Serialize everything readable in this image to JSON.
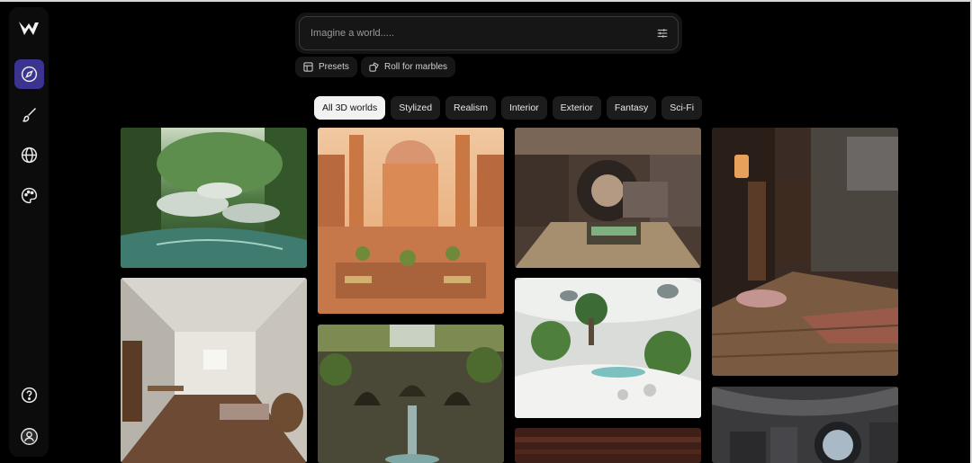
{
  "sidebar": {
    "logo": "marble-logo-icon",
    "items": [
      {
        "icon": "compass-icon",
        "active": true
      },
      {
        "icon": "paintbrush-icon",
        "active": false
      },
      {
        "icon": "globe-icon",
        "active": false
      },
      {
        "icon": "palette-icon",
        "active": false
      }
    ],
    "bottom": [
      {
        "icon": "help-icon"
      },
      {
        "icon": "user-icon"
      }
    ]
  },
  "search": {
    "placeholder": "Imagine a world.....",
    "filter_icon": "sliders-icon"
  },
  "actions": {
    "presets_label": "Presets",
    "roll_label": "Roll for marbles"
  },
  "tabs": [
    {
      "label": "All 3D worlds",
      "active": true
    },
    {
      "label": "Stylized",
      "active": false
    },
    {
      "label": "Realism",
      "active": false
    },
    {
      "label": "Interior",
      "active": false
    },
    {
      "label": "Exterior",
      "active": false
    },
    {
      "label": "Fantasy",
      "active": false
    },
    {
      "label": "Sci-Fi",
      "active": false
    }
  ],
  "gallery": {
    "items": [
      {
        "subject": "forest-treehouse-lagoon"
      },
      {
        "subject": "ornate-palace-courtyard"
      },
      {
        "subject": "circular-library-room"
      },
      {
        "subject": "old-library-interior"
      },
      {
        "subject": "abandoned-hallway"
      },
      {
        "subject": "overgrown-ruins-waterfall"
      },
      {
        "subject": "white-futuristic-garden"
      },
      {
        "subject": "wooden-room"
      },
      {
        "subject": "scifi-porthole-room"
      }
    ]
  },
  "colors": {
    "background": "#000000",
    "accent": "#3a3390",
    "active_tab": "#f2f2f2"
  }
}
